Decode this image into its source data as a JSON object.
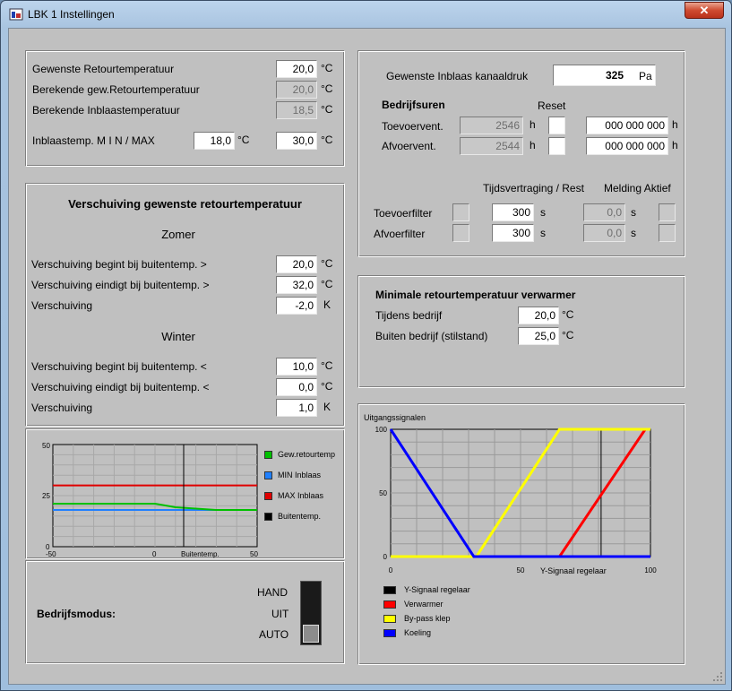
{
  "window": {
    "title": "LBK 1 Instellingen",
    "close_label": "✕"
  },
  "retour": {
    "rows": [
      {
        "label": "Gewenste Retourtemperatuur",
        "value": "20,0",
        "unit": "°C",
        "readonly": false
      },
      {
        "label": "Berekende gew.Retourtemperatuur",
        "value": "20,0",
        "unit": "°C",
        "readonly": true
      },
      {
        "label": "Berekende Inblaastemperatuur",
        "value": "18,5",
        "unit": "°C",
        "readonly": true
      }
    ],
    "minmax": {
      "label": "Inblaastemp. M I N / MAX",
      "min": "18,0",
      "max": "30,0",
      "unit": "°C"
    }
  },
  "verschuiving": {
    "title": "Verschuiving gewenste retourtemperatuur",
    "zomer": {
      "heading": "Zomer",
      "rows": [
        {
          "label": "Verschuiving begint bij buitentemp.  >",
          "value": "20,0",
          "unit": "°C"
        },
        {
          "label": "Verschuiving eindigt bij buitentemp.  >",
          "value": "32,0",
          "unit": "°C"
        },
        {
          "label": "Verschuiving",
          "value": "-2,0",
          "unit": "K"
        }
      ]
    },
    "winter": {
      "heading": "Winter",
      "rows": [
        {
          "label": "Verschuiving begint bij buitentemp.  <",
          "value": "10,0",
          "unit": "°C"
        },
        {
          "label": "Verschuiving eindigt bij buitentemp.  <",
          "value": "0,0",
          "unit": "°C"
        },
        {
          "label": "Verschuiving",
          "value": "1,0",
          "unit": "K"
        }
      ]
    }
  },
  "small_chart": {
    "y_ticks": [
      "50",
      "25",
      "0"
    ],
    "x_ticks": [
      "-50",
      "0",
      "Buitentemp.",
      "50"
    ],
    "legend": [
      {
        "label": "Gew.retourtemp",
        "color": "#00c000"
      },
      {
        "label": "MIN Inblaas",
        "color": "#2080ff"
      },
      {
        "label": "MAX Inblaas",
        "color": "#e00000"
      },
      {
        "label": "Buitentemp.",
        "color": "#000000"
      }
    ]
  },
  "bedrijfsmodus": {
    "label": "Bedrijfsmodus:",
    "options": [
      "HAND",
      "UIT",
      "AUTO"
    ],
    "selected": "AUTO"
  },
  "kanaaldruk": {
    "label": "Gewenste Inblaas kanaaldruk",
    "value": "325",
    "unit": "Pa",
    "bedrijfsuren_label": "Bedrijfsuren",
    "reset_label": "Reset",
    "rows": [
      {
        "label": "Toevoervent.",
        "hours": "2546",
        "unit": "h",
        "counter": "000 000 000",
        "counter_unit": "h"
      },
      {
        "label": "Afvoervent.",
        "hours": "2544",
        "unit": "h",
        "counter": "000 000 000",
        "counter_unit": "h"
      }
    ],
    "col_tijds": "Tijdsvertraging / Rest",
    "col_melding": "Melding Aktief",
    "filters": [
      {
        "label": "Toevoerfilter",
        "delay": "300",
        "unit": "s",
        "rest": "0,0",
        "rest_unit": "s"
      },
      {
        "label": "Afvoerfilter",
        "delay": "300",
        "unit": "s",
        "rest": "0,0",
        "rest_unit": "s"
      }
    ]
  },
  "minimale": {
    "title": "Minimale retourtemperatuur verwarmer",
    "rows": [
      {
        "label": "Tijdens bedrijf",
        "value": "20,0",
        "unit": "°C"
      },
      {
        "label": "Buiten bedrijf (stilstand)",
        "value": "25,0",
        "unit": "°C"
      }
    ]
  },
  "chart_data": {
    "type": "line",
    "title": "Uitgangssignalen",
    "xlabel": "Y-Signaal regelaar",
    "ylabel": "",
    "xlim": [
      0,
      100
    ],
    "ylim": [
      0,
      100
    ],
    "x_ticks": [
      "0",
      "50",
      "100"
    ],
    "y_ticks": [
      "100",
      "50",
      "0"
    ],
    "grid": true,
    "legend_position": "bottom",
    "series": [
      {
        "name": "Y-Signaal regelaar",
        "color": "#000000",
        "kind": "vline",
        "x": 81
      },
      {
        "name": "Verwarmer",
        "color": "#ff0000",
        "points": [
          [
            0,
            0
          ],
          [
            65,
            0
          ],
          [
            98,
            100
          ],
          [
            100,
            100
          ]
        ]
      },
      {
        "name": "By-pass klep",
        "color": "#ffff00",
        "points": [
          [
            0,
            0
          ],
          [
            33,
            0
          ],
          [
            65,
            100
          ],
          [
            100,
            100
          ]
        ]
      },
      {
        "name": "Koeling",
        "color": "#0000ff",
        "points": [
          [
            0,
            100
          ],
          [
            32,
            0
          ],
          [
            100,
            0
          ]
        ]
      }
    ]
  }
}
